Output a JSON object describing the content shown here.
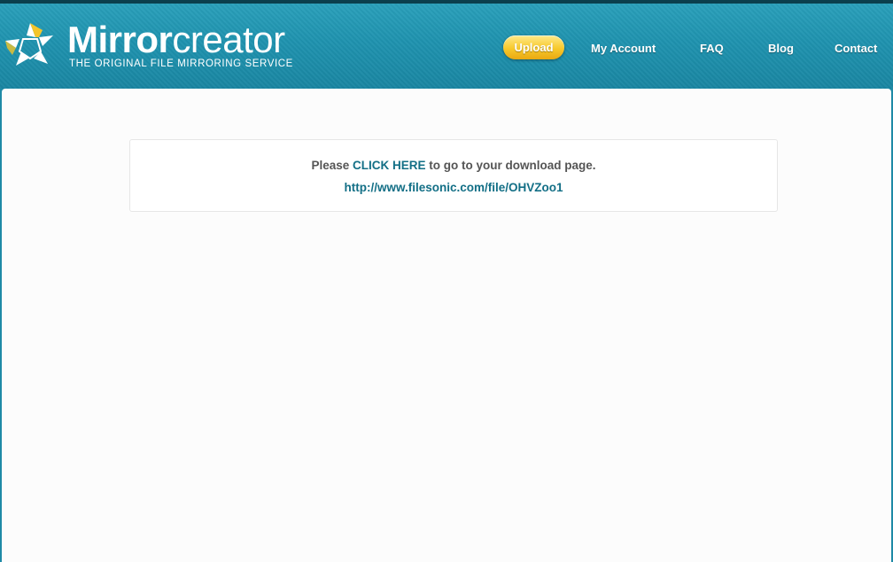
{
  "brand": {
    "name_bold": "Mirror",
    "name_light": "creator",
    "tagline": "THE ORIGINAL FILE MIRRORING SERVICE",
    "logo_icon": "star-swirl-icon"
  },
  "nav": {
    "upload": "Upload",
    "my_account": "My Account",
    "faq": "FAQ",
    "blog": "Blog",
    "contact": "Contact"
  },
  "notice": {
    "prefix": "Please ",
    "link_text": "CLICK HERE",
    "suffix": " to go to your download page.",
    "url": "http://www.filesonic.com/file/OHVZoo1"
  },
  "colors": {
    "header": "#1f93af",
    "upload_button": "#f7c92b",
    "link": "#136f86",
    "text": "#555555"
  }
}
